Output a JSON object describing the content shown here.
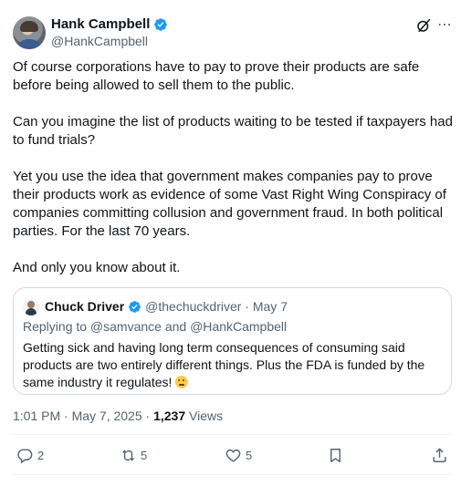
{
  "author": {
    "display_name": "Hank Campbell",
    "handle": "@HankCampbell"
  },
  "icons": {
    "verified": "verified-badge-icon",
    "grok": "grok-icon",
    "more": "more-icon"
  },
  "colors": {
    "verified": "#1d9bf0",
    "secondary_text": "#536471",
    "border": "#cfd9de"
  },
  "tweet": {
    "paragraphs": [
      "Of course corporations have to pay to prove their products are safe before being allowed to sell them to the public.",
      "Can you imagine the list of products waiting to be tested if taxpayers had to fund trials?",
      "Yet you use the idea that government makes companies pay to prove their products work as evidence of some Vast Right Wing Conspiracy of companies committing collusion and government fraud. In both political parties. For the last 70 years.",
      "And only you know about it."
    ]
  },
  "quote": {
    "display_name": "Chuck Driver",
    "handle_date": "@thechuckdriver · May 7",
    "replying_to": "Replying to @samvance and @HankCampbell",
    "text": "Getting sick and having long term consequences of consuming said products are two entirely different things. Plus the FDA is funded by the same industry it regulates!"
  },
  "meta": {
    "timestamp": "1:01 PM · May 7, 2025 · ",
    "views_count": "1,237",
    "views_label": " Views"
  },
  "actions": {
    "replies": "2",
    "reposts": "5",
    "likes": "5"
  }
}
